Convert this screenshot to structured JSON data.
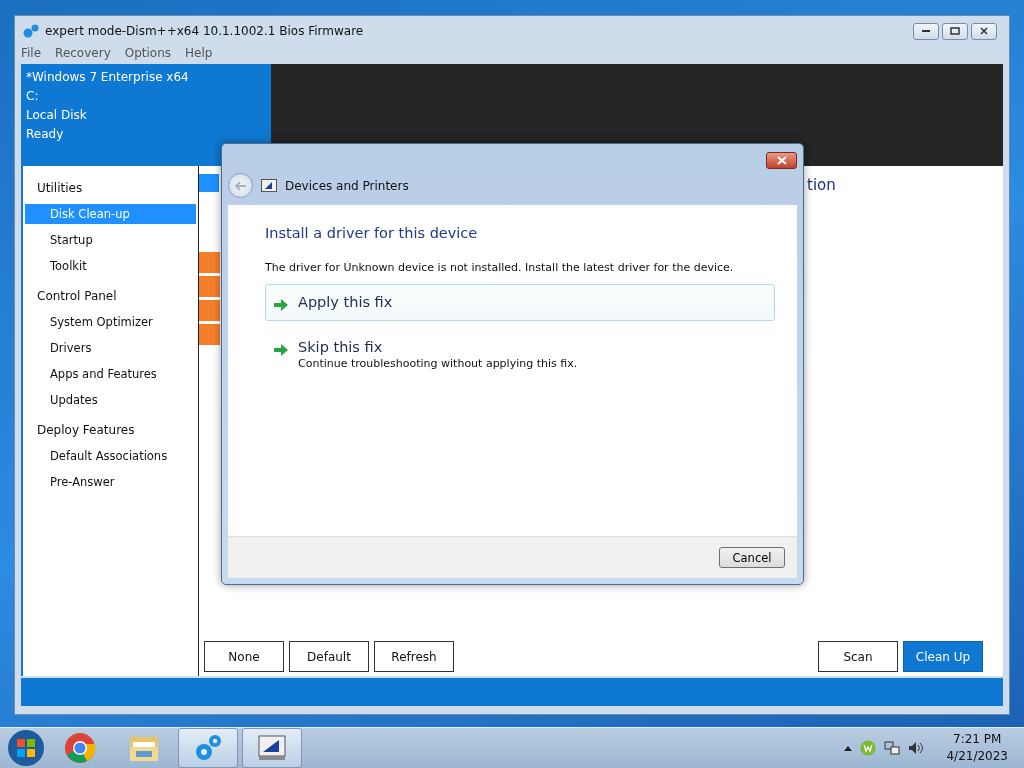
{
  "window": {
    "title": "expert mode-Dism++x64 10.1.1002.1 Bios Firmware",
    "menu": [
      "File",
      "Recovery",
      "Options",
      "Help"
    ]
  },
  "header": {
    "lines": [
      "*Windows 7 Enterprise x64",
      "C:",
      "Local Disk",
      "Ready"
    ]
  },
  "sidebar": {
    "groups": [
      {
        "label": "Utilities",
        "items": [
          {
            "label": "Disk Clean-up",
            "selected": true
          },
          {
            "label": "Startup",
            "selected": false
          },
          {
            "label": "Toolkit",
            "selected": false
          }
        ]
      },
      {
        "label": "Control Panel",
        "items": [
          {
            "label": "System Optimizer",
            "selected": false
          },
          {
            "label": "Drivers",
            "selected": false
          },
          {
            "label": "Apps and Features",
            "selected": false
          },
          {
            "label": "Updates",
            "selected": false
          }
        ]
      },
      {
        "label": "Deploy Features",
        "items": [
          {
            "label": "Default Associations",
            "selected": false
          },
          {
            "label": "Pre-Answer",
            "selected": false
          }
        ]
      }
    ]
  },
  "content": {
    "heading_fragment": "tion",
    "buttons_left": [
      "None",
      "Default",
      "Refresh"
    ],
    "buttons_right": [
      {
        "label": "Scan",
        "kind": "normal"
      },
      {
        "label": "Clean Up",
        "kind": "primary"
      }
    ]
  },
  "dialog": {
    "title": "Devices and Printers",
    "heading": "Install a driver for this device",
    "message": "The driver for Unknown device is not installed. Install the latest driver for the device.",
    "options": [
      {
        "label": "Apply this fix",
        "selected": true
      },
      {
        "label": "Skip this fix",
        "description": "Continue troubleshooting without applying this fix.",
        "selected": false
      }
    ],
    "cancel": "Cancel"
  },
  "taskbar": {
    "apps": [
      {
        "kind": "chrome",
        "active": false
      },
      {
        "kind": "explorer",
        "active": false
      },
      {
        "kind": "gears",
        "active": true
      },
      {
        "kind": "devices",
        "active": true
      }
    ],
    "time": "7:21 PM",
    "date": "4/21/2023"
  }
}
